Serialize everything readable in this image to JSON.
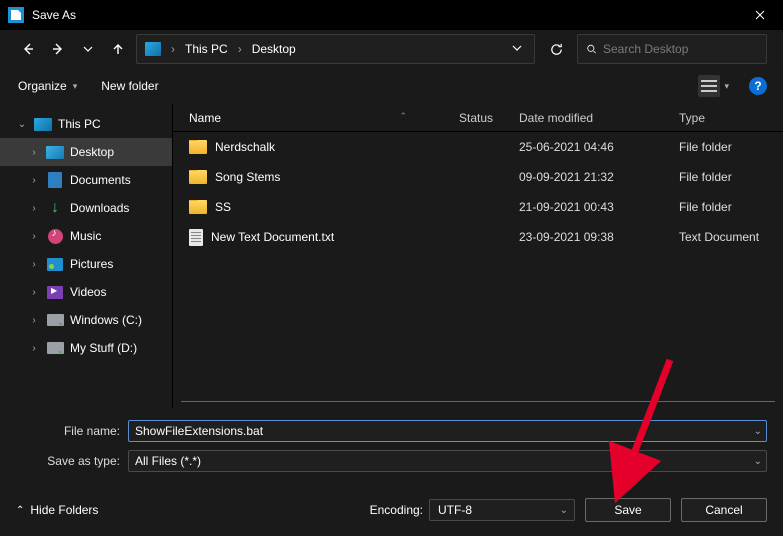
{
  "window": {
    "title": "Save As"
  },
  "breadcrumb": {
    "root": "This PC",
    "current": "Desktop"
  },
  "search": {
    "placeholder": "Search Desktop"
  },
  "toolbar": {
    "organize": "Organize",
    "newfolder": "New folder"
  },
  "tree": {
    "root": "This PC",
    "items": [
      {
        "label": "Desktop"
      },
      {
        "label": "Documents"
      },
      {
        "label": "Downloads"
      },
      {
        "label": "Music"
      },
      {
        "label": "Pictures"
      },
      {
        "label": "Videos"
      },
      {
        "label": "Windows (C:)"
      },
      {
        "label": "My Stuff (D:)"
      }
    ]
  },
  "columns": {
    "name": "Name",
    "status": "Status",
    "date": "Date modified",
    "type": "Type"
  },
  "files": [
    {
      "name": "Nerdschalk",
      "date": "25-06-2021 04:46",
      "type": "File folder",
      "kind": "folder"
    },
    {
      "name": "Song Stems",
      "date": "09-09-2021 21:32",
      "type": "File folder",
      "kind": "folder"
    },
    {
      "name": "SS",
      "date": "21-09-2021 00:43",
      "type": "File folder",
      "kind": "folder"
    },
    {
      "name": "New Text Document.txt",
      "date": "23-09-2021 09:38",
      "type": "Text Document",
      "kind": "txt"
    }
  ],
  "form": {
    "filename_label": "File name:",
    "filename_value": "ShowFileExtensions.bat",
    "savetype_label": "Save as type:",
    "savetype_value": "All Files  (*.*)"
  },
  "footer": {
    "hide": "Hide Folders",
    "encoding_label": "Encoding:",
    "encoding_value": "UTF-8",
    "save": "Save",
    "cancel": "Cancel"
  }
}
